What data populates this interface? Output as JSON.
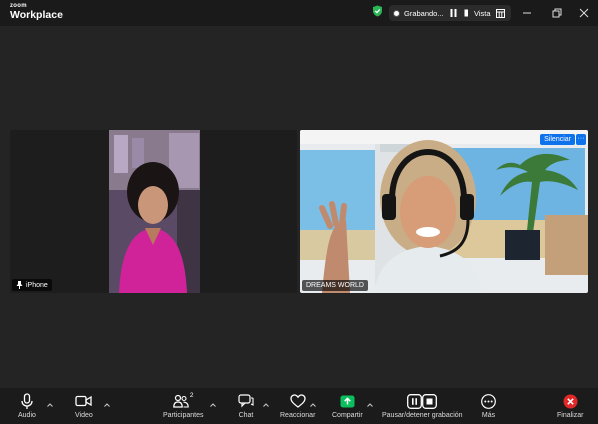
{
  "app": {
    "brand_small": "zoom",
    "brand_name": "Workplace"
  },
  "status": {
    "recording_label": "Grabando...",
    "view_label": "Vista"
  },
  "participants": [
    {
      "name": "iPhone"
    },
    {
      "name": "DREAMS WORLD",
      "mute_button": "Silenciar",
      "more": "···"
    }
  ],
  "toolbar": {
    "audio": "Audio",
    "video": "Video",
    "participants": "Participantes",
    "participant_count": "2",
    "chat": "Chat",
    "react": "Reaccionar",
    "share": "Compartir",
    "recording": "Pausar/detener grabación",
    "more": "Más",
    "end": "Finalizar"
  },
  "colors": {
    "accent": "#0e72ed",
    "share_green": "#0bbf5c",
    "end_red": "#e02828",
    "shield_green": "#2ab656"
  }
}
